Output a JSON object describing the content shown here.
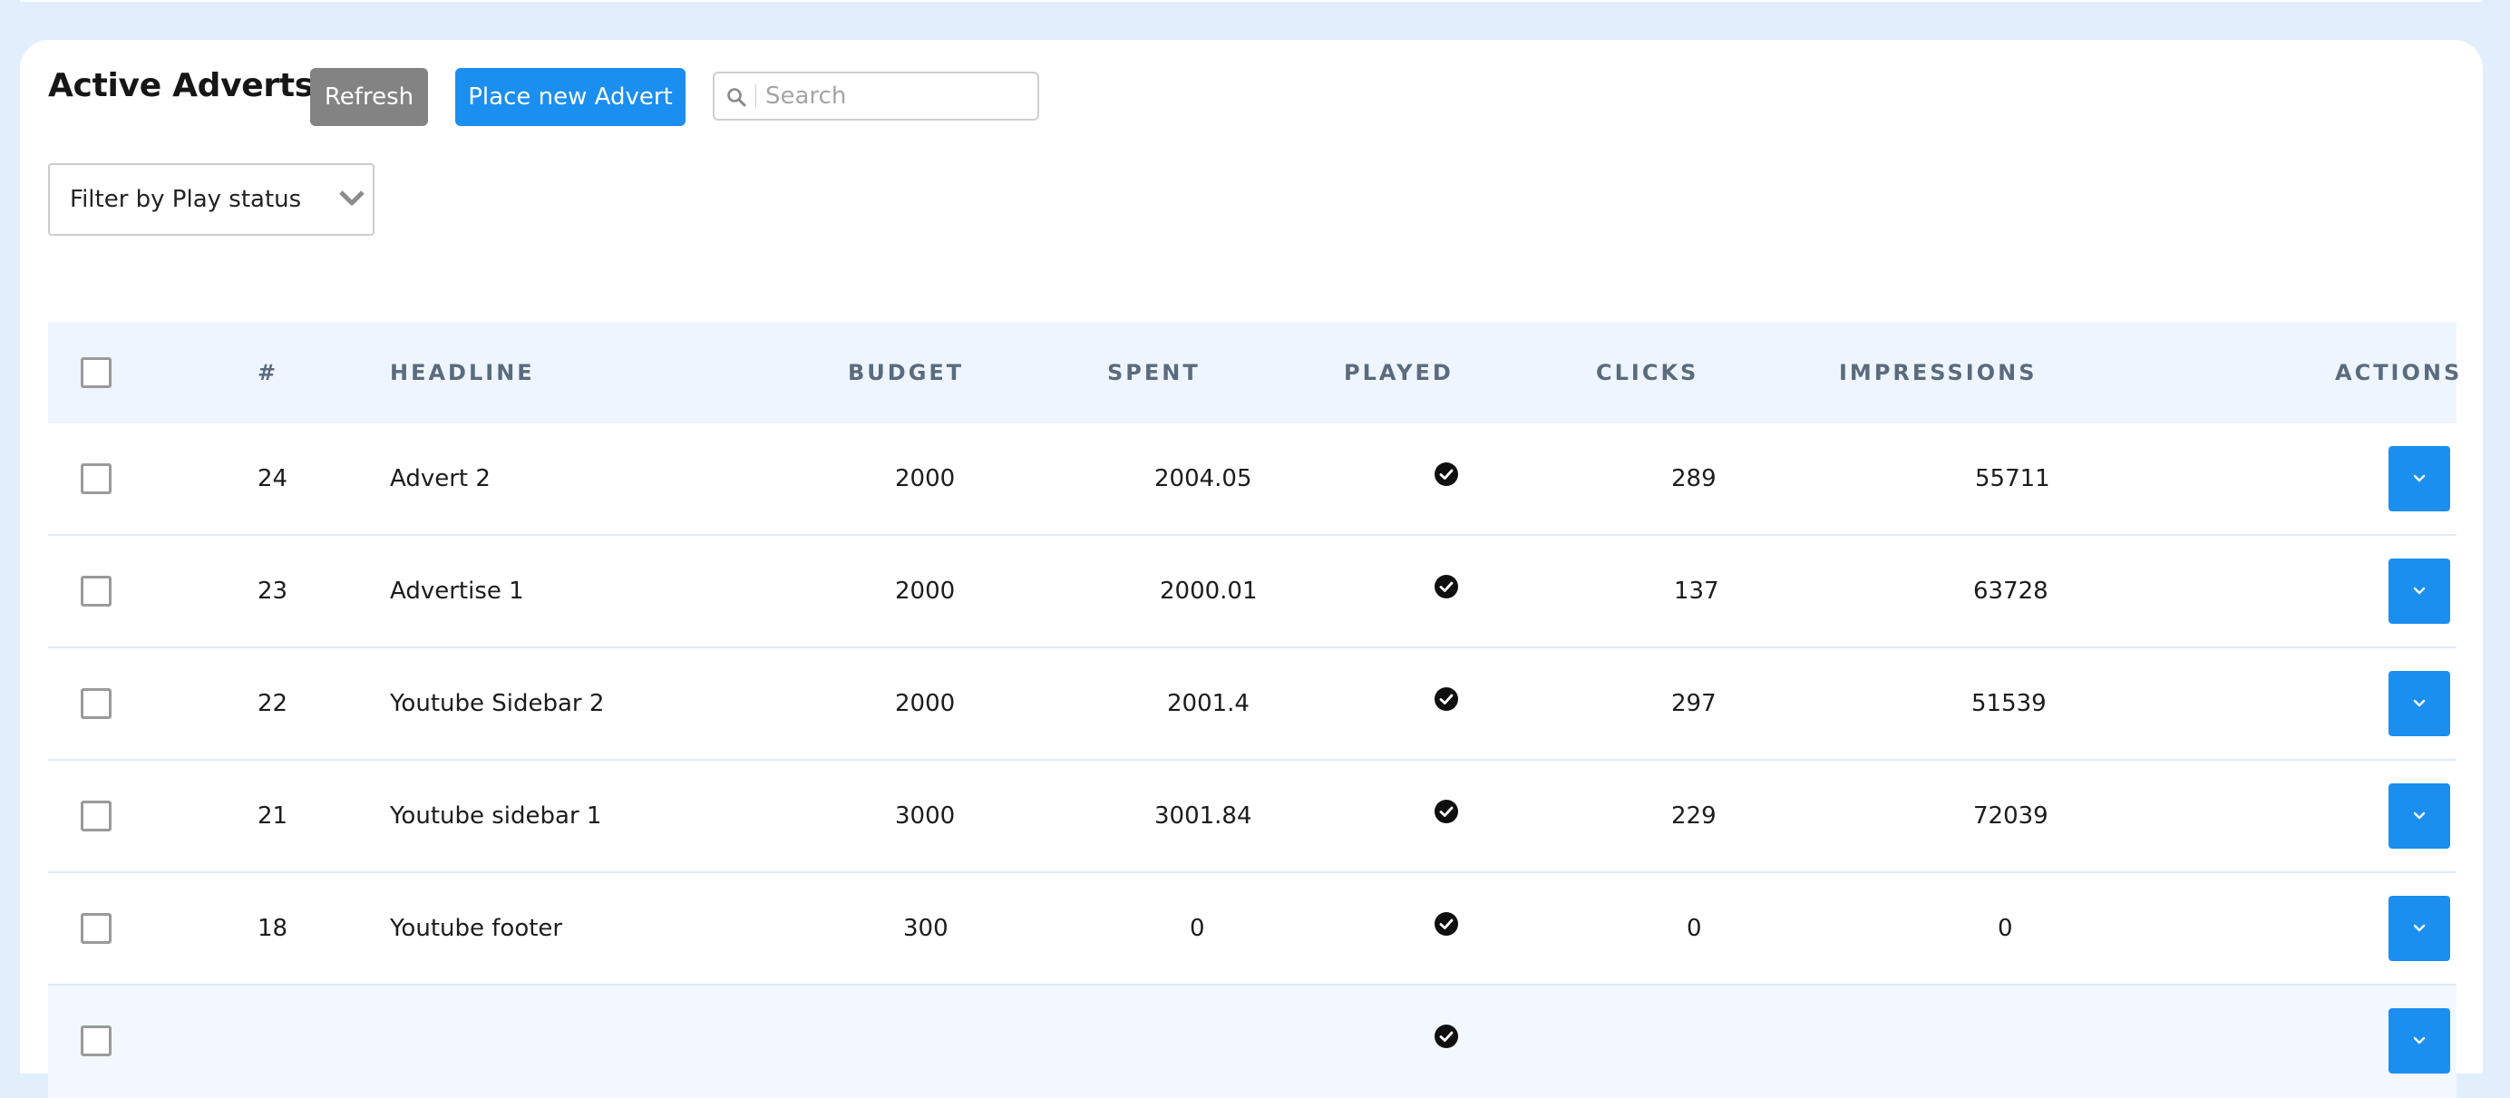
{
  "header": {
    "title": "Active Adverts",
    "refresh_label": "Refresh",
    "place_label": "Place new Advert"
  },
  "search": {
    "placeholder": "Search",
    "value": ""
  },
  "filter": {
    "selected": "Filter by Play status"
  },
  "table": {
    "columns": {
      "id": "#",
      "headline": "HEADLINE",
      "budget": "BUDGET",
      "spent": "SPENT",
      "played": "PLAYED",
      "clicks": "CLICKS",
      "impressions": "IMPRESSIONS",
      "actions": "ACTIONS"
    },
    "rows": [
      {
        "id": "24",
        "headline": "Advert 2",
        "budget": "2000",
        "spent": "2004.05",
        "played": true,
        "clicks": "289",
        "impressions": "55711"
      },
      {
        "id": "23",
        "headline": "Advertise 1",
        "budget": "2000",
        "spent": "2000.01",
        "played": true,
        "clicks": "137",
        "impressions": "63728"
      },
      {
        "id": "22",
        "headline": "Youtube Sidebar 2",
        "budget": "2000",
        "spent": "2001.4",
        "played": true,
        "clicks": "297",
        "impressions": "51539"
      },
      {
        "id": "21",
        "headline": "Youtube sidebar 1",
        "budget": "3000",
        "spent": "3001.84",
        "played": true,
        "clicks": "229",
        "impressions": "72039"
      },
      {
        "id": "18",
        "headline": "Youtube footer",
        "budget": "300",
        "spent": "0",
        "played": true,
        "clicks": "0",
        "impressions": "0"
      }
    ]
  },
  "icons": {
    "search": "search-icon",
    "chevron": "chevron-down-icon",
    "played": "check-circle-icon"
  },
  "colors": {
    "background": "#e1effd",
    "primary": "#1a8ff0",
    "refresh": "#838383",
    "header_row": "#eef5fe",
    "header_text": "#5b6b7e"
  }
}
